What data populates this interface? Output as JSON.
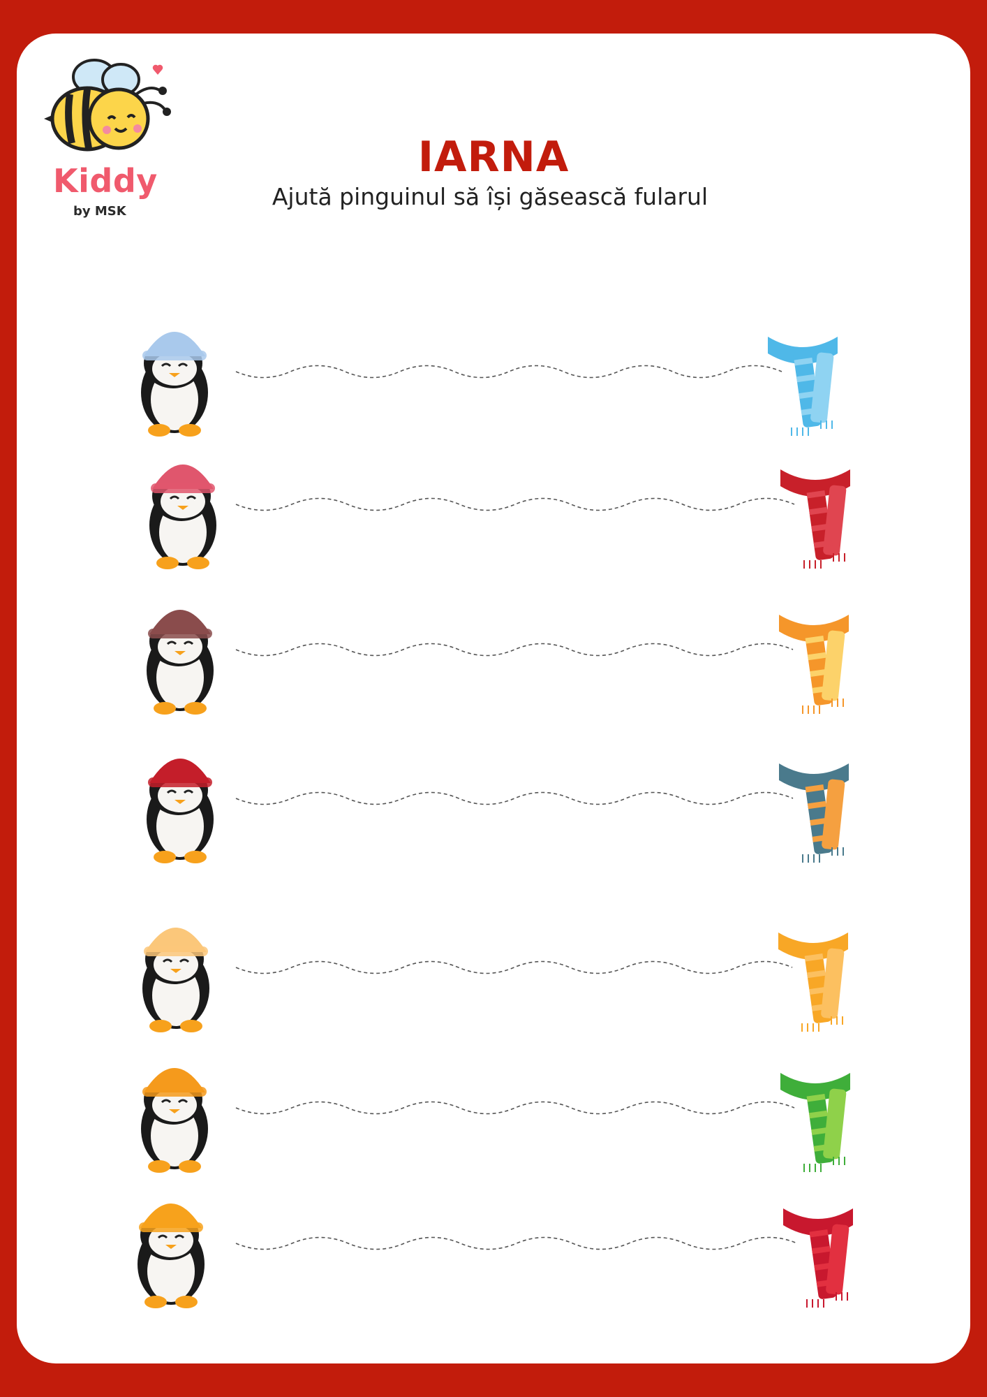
{
  "brand": {
    "name": "Kiddy",
    "sub": "by MSK"
  },
  "title": "IARNA",
  "instruction": "Ajută pinguinul să își găsească fularul",
  "colors": {
    "frame": "#c21c0c",
    "title": "#c21c0c",
    "brand": "#f05a6d",
    "trace": "#555555"
  },
  "rows": [
    {
      "penguin": "penguin-blue-hat-icon",
      "scarf": "blue-striped-scarf-icon",
      "hat": "#a9c9ec",
      "scarf_color": "#4fb8e8",
      "scarf_alt": "#8fd3f2"
    },
    {
      "penguin": "penguin-pink-beanie-icon",
      "scarf": "red-snowflake-scarf-icon",
      "hat": "#e0566d",
      "scarf_color": "#c8202a",
      "scarf_alt": "#e04550"
    },
    {
      "penguin": "penguin-brown-earflap-hat-icon",
      "scarf": "orange-striped-scarf-icon",
      "hat": "#8a4c4c",
      "scarf_color": "#f5962a",
      "scarf_alt": "#fcd26a"
    },
    {
      "penguin": "penguin-red-hat-jacket-icon",
      "scarf": "teal-striped-scarf-icon",
      "hat": "#c41e2a",
      "scarf_color": "#4a7a8c",
      "scarf_alt": "#f5a040"
    },
    {
      "penguin": "penguin-yellow-hat-icon",
      "scarf": "yellow-scarf-icon",
      "hat": "#fbc77a",
      "scarf_color": "#f8a726",
      "scarf_alt": "#fcc060"
    },
    {
      "penguin": "penguin-earmuffs-sweater-icon",
      "scarf": "green-striped-scarf-icon",
      "hat": "#f59a1c",
      "scarf_color": "#3fae3a",
      "scarf_alt": "#8fd14a"
    },
    {
      "penguin": "penguin-orange-ushanka-icon",
      "scarf": "red-star-scarf-icon",
      "hat": "#f7a21c",
      "scarf_color": "#c8182e",
      "scarf_alt": "#e23040"
    }
  ]
}
